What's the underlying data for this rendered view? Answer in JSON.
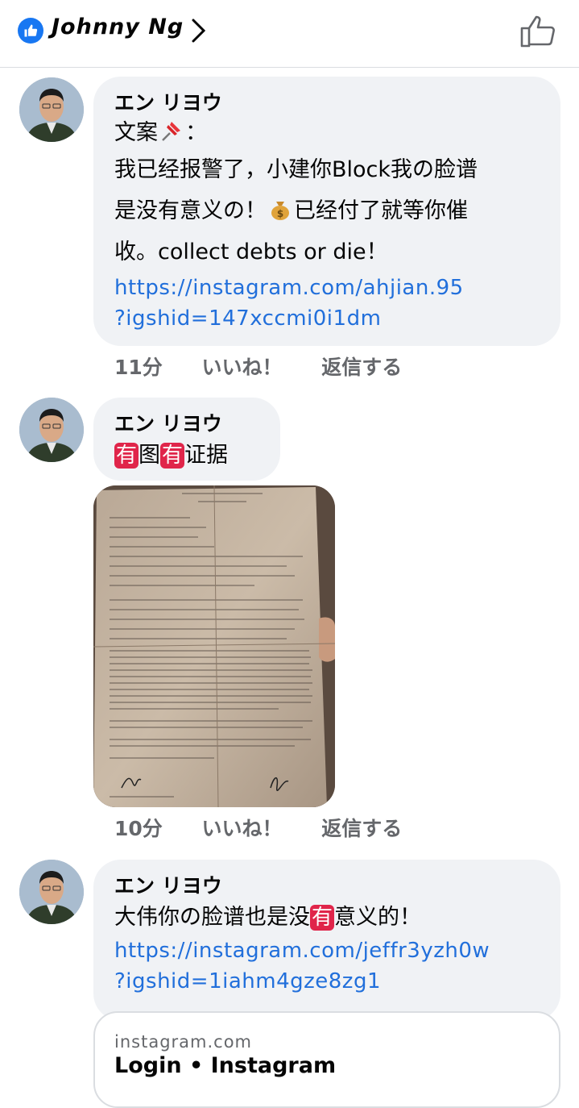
{
  "header": {
    "name": "Johnny Ng"
  },
  "comments": [
    {
      "author": "エン リヨウ",
      "line1_text": "文案",
      "line1_suffix": "：",
      "line2": "我已经报警了，小建你Block我の脸谱",
      "line3_a": "是没有意义の！",
      "line3_b": "已经付了就等你催",
      "line4": "收。collect debts or die！",
      "link_line1": "https://instagram.com/ahjian.95",
      "link_line2": "?igshid=147xccmi0i1dm",
      "time": "11分",
      "like": "いいね！",
      "reply": "返信する"
    },
    {
      "author": "エン リヨウ",
      "badge1": "有",
      "mid": "图",
      "badge2": "有",
      "tail": "证据",
      "time": "10分",
      "like": "いいね！",
      "reply": "返信する"
    },
    {
      "author": "エン リヨウ",
      "text_a": "大伟你の脸谱也是没",
      "badge": "有",
      "text_b": "意义的！",
      "link_line1": "https://instagram.com/jeffr3yzh0w",
      "link_line2": "?igshid=1iahm4gze8zg1",
      "preview_domain": "instagram.com",
      "preview_title": "Login • Instagram"
    }
  ],
  "icons": {
    "header_like": "like-badge-icon",
    "chevron": "chevron-right-icon",
    "thumb": "thumbs-up-icon",
    "pin": "pushpin-emoji",
    "money": "money-bag-emoji"
  },
  "colors": {
    "link": "#216fdb",
    "bubble": "#f0f2f5",
    "brand": "#1877f2",
    "badge_red": "#e0254a"
  }
}
